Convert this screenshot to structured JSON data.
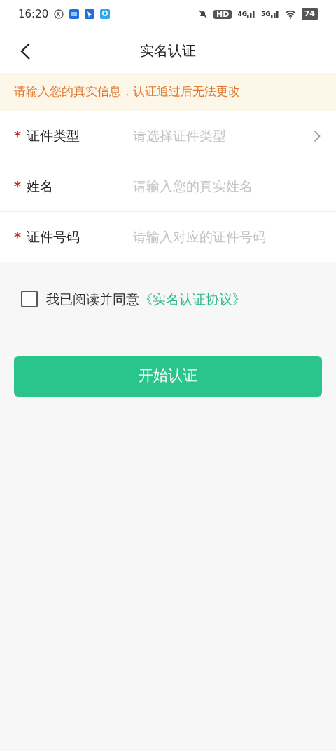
{
  "status_bar": {
    "time": "16:20",
    "hd": "HD",
    "networks": [
      "4G",
      "5G"
    ],
    "battery": "74"
  },
  "header": {
    "title": "实名认证"
  },
  "notice": "请输入您的真实信息，认证通过后无法更改",
  "fields": [
    {
      "kind": "select",
      "required_mark": "*",
      "label": "证件类型",
      "placeholder": "请选择证件类型"
    },
    {
      "kind": "input",
      "required_mark": "*",
      "label": "姓名",
      "placeholder": "请输入您的真实姓名"
    },
    {
      "kind": "input",
      "required_mark": "*",
      "label": "证件号码",
      "placeholder": "请输入对应的证件号码"
    }
  ],
  "agreement": {
    "checked": false,
    "text": "我已阅读并同意",
    "link": "《实名认证协议》"
  },
  "submit_button": "开始认证"
}
